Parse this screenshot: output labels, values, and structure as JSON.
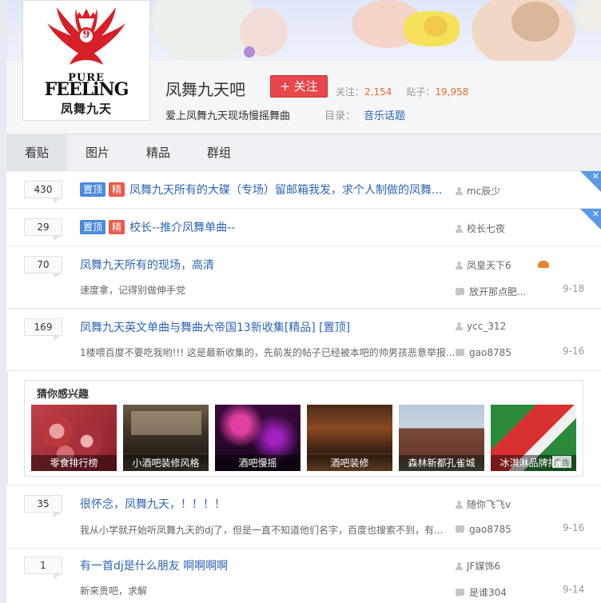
{
  "forum": {
    "name": "凤舞九天吧",
    "follow_label": "+ 关注",
    "follow_stat_label": "关注：",
    "follow_count": "2,154",
    "post_stat_label": "贴子：",
    "post_count": "19,958",
    "slogan": "爱上凤舞九天现场慢摇舞曲",
    "catalog_label": "目录：",
    "catalog_value": "音乐话题"
  },
  "logo": {
    "crest_number": "9",
    "text_line1": "PURE",
    "text_line2": "FEELiNG",
    "text_cn": "凤舞九天"
  },
  "tabs": [
    {
      "label": "看贴",
      "active": true
    },
    {
      "label": "图片",
      "active": false
    },
    {
      "label": "精品",
      "active": false
    },
    {
      "label": "群组",
      "active": false
    }
  ],
  "threads": [
    {
      "replies": "430",
      "badges": [
        "置顶",
        "精"
      ],
      "title": "凤舞九天所有的大碟（专场）留邮箱我发，求个人制做的凤舞...",
      "author": "mc辰少"
    },
    {
      "replies": "29",
      "badges": [
        "置顶",
        "精"
      ],
      "title": "校长--推介凤舞单曲--",
      "author": "校长七夜"
    },
    {
      "replies": "70",
      "title": "凤舞九天所有的现场，高清",
      "abstract": "速度拿，记得别做伸手党",
      "author": "凤皇天下6",
      "last_reply": "放开那点肥...",
      "date": "9-18"
    },
    {
      "replies": "169",
      "title": "凤舞九天英文单曲与舞曲大帝国13新收集[精品] [置顶]",
      "abstract": "1楼喂百度不要吃我哟!!! 这是最新收集的，先前发的帖子已经被本吧的帅男孩恶意举报...",
      "author": "ycc_312",
      "last_reply": "gao8785",
      "date": "9-16"
    },
    {
      "replies": "35",
      "title": "很怀念，凤舞九天，！！！！",
      "abstract": "我从小学就开始听凤舞九天的dj了，但是一直不知道他们名字，百度也搜索不到，有...",
      "author": "随你飞飞v",
      "last_reply": "gao8785",
      "date": "9-16"
    },
    {
      "replies": "1",
      "title": "有一首dj是什么朋友 啊啊啊啊",
      "abstract": "新来贵吧，求解",
      "author": "JF媒饰6",
      "last_reply": "是谁304",
      "date": "9-14"
    }
  ],
  "recommend": {
    "title": "猜你感兴趣",
    "items": [
      "零食排行榜",
      "小酒吧装修风格",
      "酒吧慢摇",
      "酒吧装修",
      "森林新都孔雀城",
      "冰淇淋品牌排行"
    ],
    "ad_label": "广告"
  },
  "colors": {
    "link": "#2d64b3",
    "follow": "#e8474b",
    "badge_top": "#4a8bdc",
    "badge_jing": "#e85a4f",
    "count": "#e66d2c"
  }
}
